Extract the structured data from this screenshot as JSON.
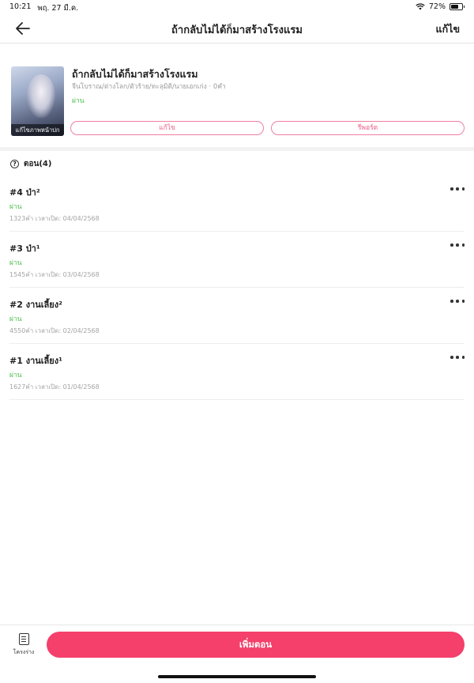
{
  "status_bar": {
    "time": "10:21",
    "date": "พฤ. 27 มี.ค.",
    "wifi_icon": "wifi-icon",
    "battery_text": "72%",
    "battery_level": 0.72
  },
  "nav": {
    "back_icon": "arrow-left-icon",
    "title": "ถ้ากลับไม่ได้ก็มาสร้างโรงแรม",
    "action_label": "แก้ไข"
  },
  "novel": {
    "title": "ถ้ากลับไม่ได้ก็มาสร้างโรงแรม",
    "meta": "จีนโบราณ/ต่างโลก/ตัวร้าย/ทะลุมิติ/นายเอกเก่ง · 0คำ",
    "status": "ผ่าน",
    "cover_edit_label": "แก้ไขภาพหน้าปก",
    "edit_button": "แก้ไข",
    "report_button": "รีพอร์ต"
  },
  "episodes": {
    "header": "ตอน(4)",
    "items": [
      {
        "title": "#4 ป่า²",
        "status": "ผ่าน",
        "meta": "1323คำ เวลาเปิด: 04/04/2568"
      },
      {
        "title": "#3 ป่า¹",
        "status": "ผ่าน",
        "meta": "1545คำ เวลาเปิด: 03/04/2568"
      },
      {
        "title": "#2 งานเลี้ยง²",
        "status": "ผ่าน",
        "meta": "4550คำ เวลาเปิด: 02/04/2568"
      },
      {
        "title": "#1 งานเลี้ยง¹",
        "status": "ผ่าน",
        "meta": "1627คำ เวลาเปิด: 01/04/2568"
      }
    ]
  },
  "bottom": {
    "outline_label": "โครงร่าง",
    "add_episode_label": "เพิ่มตอน"
  },
  "colors": {
    "accent": "#f4406b",
    "outline_pink": "#f07ea3",
    "status_green": "#4cbf4c"
  }
}
